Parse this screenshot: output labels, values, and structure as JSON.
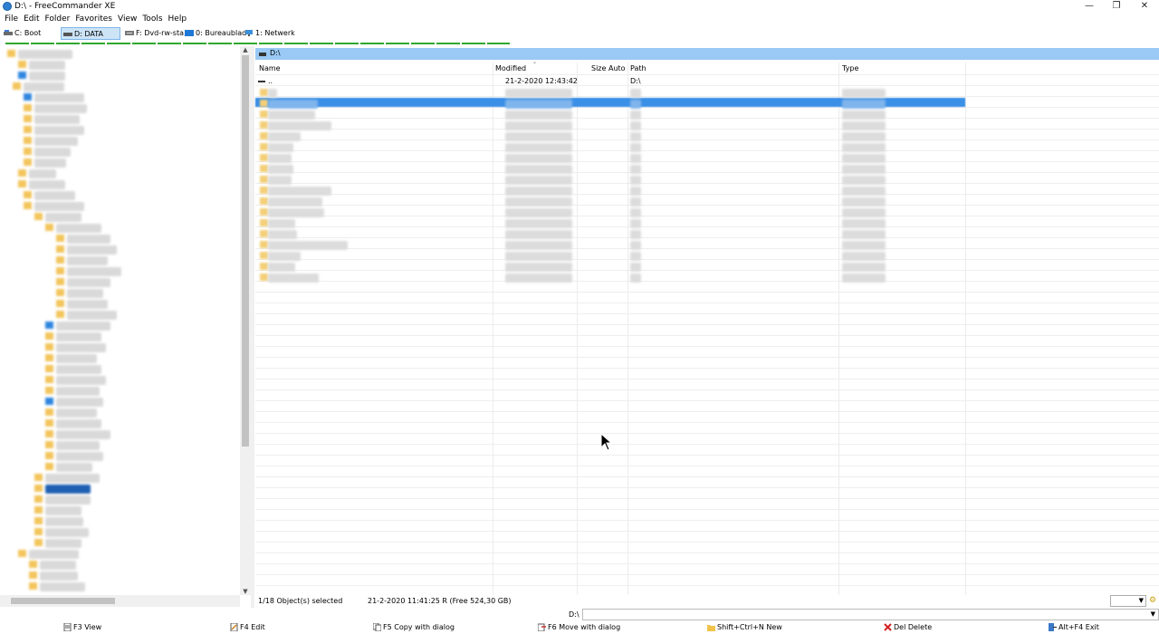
{
  "window": {
    "title": "D:\\ - FreeCommander XE",
    "minimize": "—",
    "restore": "❐",
    "close": "✕"
  },
  "menu": [
    "File",
    "Edit",
    "Folder",
    "Favorites",
    "View",
    "Tools",
    "Help"
  ],
  "drives": [
    {
      "label": "C: Boot",
      "active": false
    },
    {
      "label": "D: DATA",
      "active": true
    },
    {
      "label": "F: Dvd-rw-sta...",
      "active": false
    },
    {
      "label": "0: Bureaublad",
      "active": false
    },
    {
      "label": "1: Netwerk",
      "active": false
    }
  ],
  "panel": {
    "path": "D:\\",
    "columns": {
      "name": "Name",
      "modified": "Modified",
      "size": "Size Auto",
      "path": "Path",
      "type": "Type"
    },
    "parent_row": {
      "name": "..",
      "modified": "21-2-2020 12:43:42",
      "path": "D:\\"
    }
  },
  "status": {
    "selected": "1/18 Object(s) selected",
    "info": "21-2-2020 11:41:25  R  (Free 524,30 GB)"
  },
  "cmdline": {
    "label": "D:\\"
  },
  "fkeys": [
    "F3 View",
    "F4 Edit",
    "F5 Copy with dialog",
    "F6 Move with dialog",
    "Shift+Ctrl+N New",
    "Del Delete",
    "Alt+F4 Exit"
  ],
  "icons": [
    "app-icon",
    "drive-icon",
    "folder-icon",
    "delete-icon",
    "cursor-icon"
  ]
}
